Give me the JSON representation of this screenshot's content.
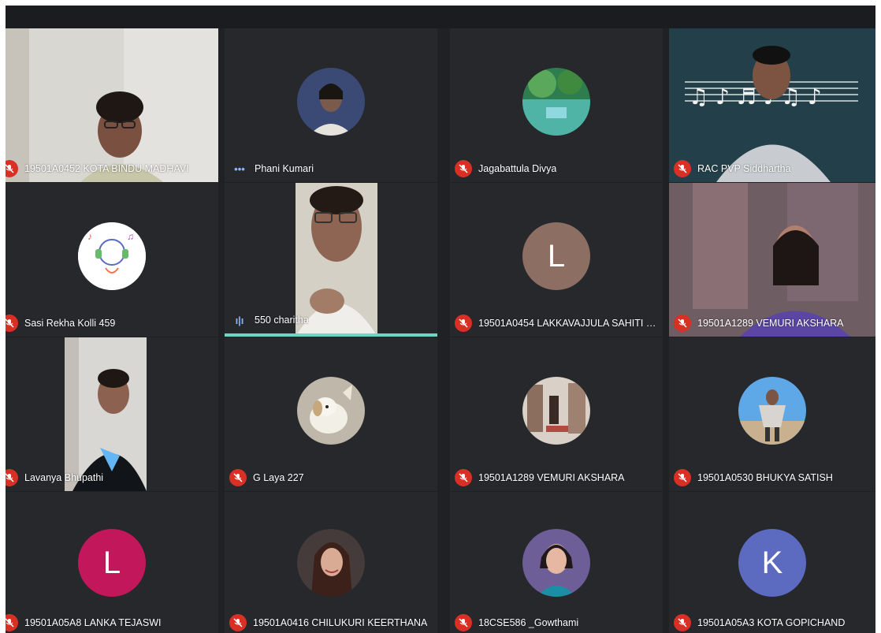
{
  "meeting": {
    "participants": [
      {
        "name": "19501A0452 KOTA BINDU MADHAVI",
        "tile": "video",
        "mic": "muted",
        "icon": "person-video"
      },
      {
        "name": "Phani Kumari",
        "tile": "avatar",
        "mic": "dots",
        "icon": "profile-photo-woman"
      },
      {
        "name": "Jagabattula Divya",
        "tile": "avatar",
        "mic": "muted",
        "icon": "profile-photo-landscape"
      },
      {
        "name": "RAC PVP Siddhartha",
        "tile": "video",
        "mic": "muted",
        "icon": "person-video-music-background"
      },
      {
        "name": "Sasi Rekha Kolli 459",
        "tile": "avatar",
        "mic": "muted",
        "icon": "profile-drawing-headphones"
      },
      {
        "name": "550 charitha",
        "tile": "video",
        "mic": "speaking",
        "icon": "person-video"
      },
      {
        "name": "19501A0454 LAKKAVAJJULA SAHITI K...",
        "tile": "letter",
        "mic": "muted",
        "letter": "L",
        "color": "#8d6e63"
      },
      {
        "name": "19501A1289 VEMURI AKSHARA",
        "tile": "video",
        "mic": "muted",
        "icon": "person-video"
      },
      {
        "name": "Lavanya Bhupathi",
        "tile": "video",
        "mic": "muted",
        "icon": "person-video"
      },
      {
        "name": "G Laya 227",
        "tile": "avatar",
        "mic": "muted",
        "icon": "profile-photo-dog"
      },
      {
        "name": "19501A1289 VEMURI AKSHARA",
        "tile": "avatar",
        "mic": "muted",
        "icon": "profile-photo-room"
      },
      {
        "name": "19501A0530 BHUKYA SATISH",
        "tile": "avatar",
        "mic": "muted",
        "icon": "profile-photo-man"
      },
      {
        "name": "19501A05A8 LANKA TEJASWI",
        "tile": "letter",
        "mic": "muted",
        "letter": "L",
        "color": "#c2185b"
      },
      {
        "name": "19501A0416 CHILUKURI KEERTHANA",
        "tile": "avatar",
        "mic": "muted",
        "icon": "profile-photo-woman"
      },
      {
        "name": "18CSE586 _Gowthami",
        "tile": "avatar",
        "mic": "muted",
        "icon": "profile-photo-woman"
      },
      {
        "name": "19501A05A3 KOTA GOPICHAND",
        "tile": "letter",
        "mic": "muted",
        "letter": "K",
        "color": "#5c6bc0"
      }
    ]
  }
}
